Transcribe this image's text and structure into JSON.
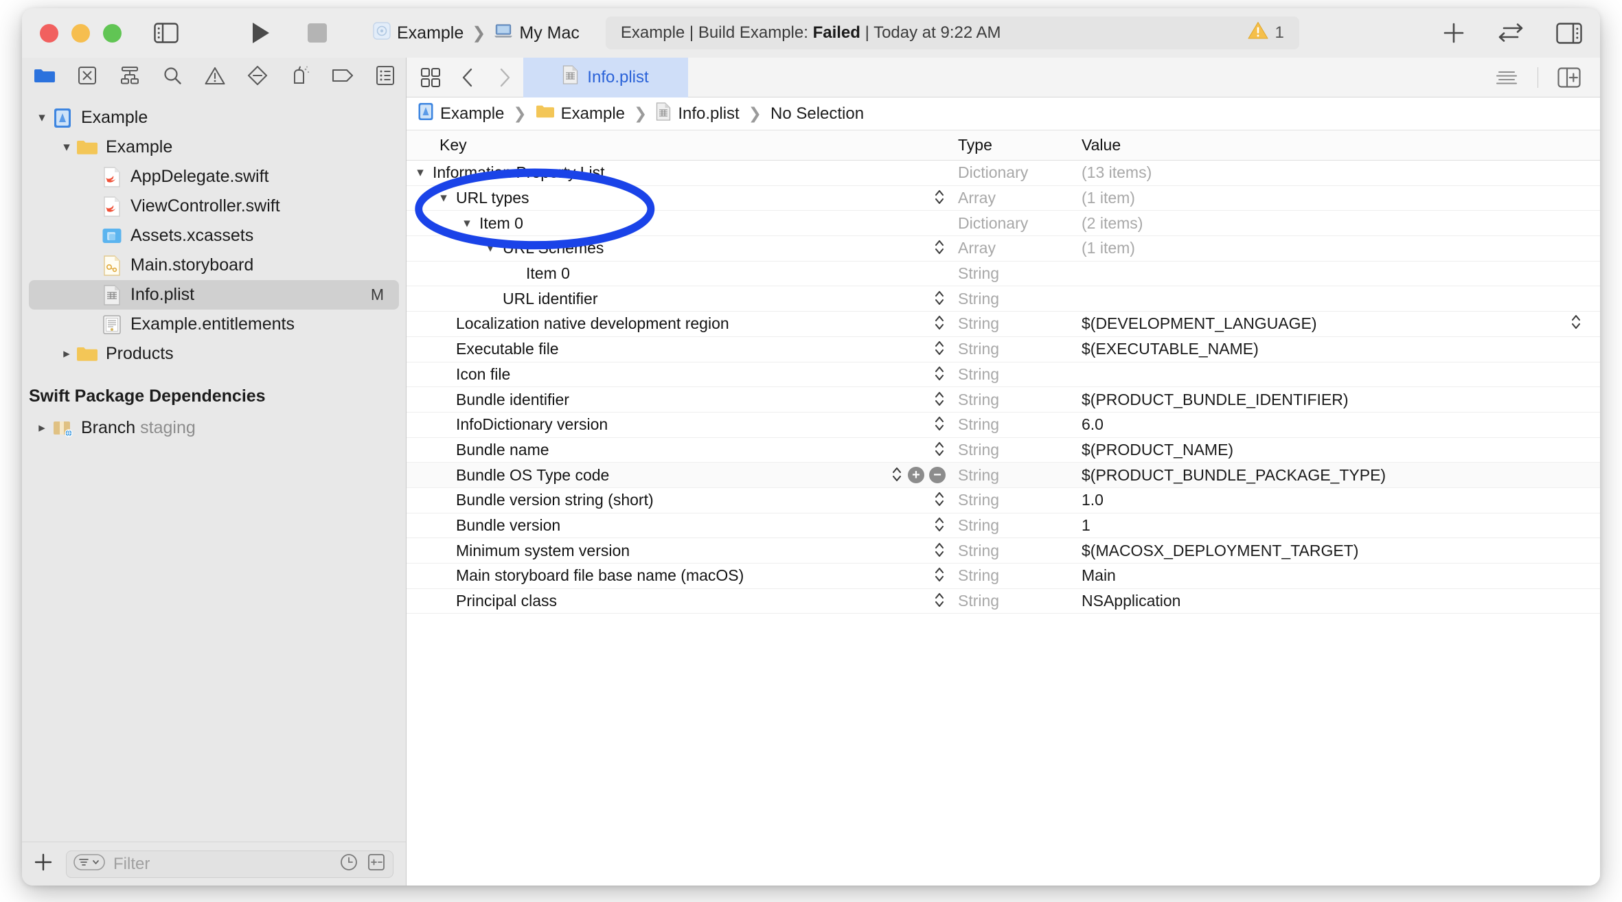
{
  "window": {
    "traffic_lights": [
      "close",
      "minimize",
      "zoom"
    ]
  },
  "toolbar": {
    "scheme_name": "Example",
    "destination": "My Mac",
    "status_prefix": "Example | Build Example: ",
    "status_result": "Failed",
    "status_suffix": " | Today at 9:22 AM",
    "separator": "|",
    "warning_count": "1",
    "add_label": "+",
    "sidebar_toggle_name": "toggle-navigator",
    "run_name": "run-button",
    "stop_name": "stop-button"
  },
  "navigator": {
    "toolbar_icons": [
      "project-navigator-icon",
      "source-control-navigator-icon",
      "hierarchy-navigator-icon",
      "find-navigator-icon",
      "issue-navigator-icon",
      "test-navigator-icon",
      "debug-navigator-icon",
      "breakpoint-navigator-icon",
      "report-navigator-icon"
    ],
    "tree": [
      {
        "label": "Example",
        "icon": "xcode-project-icon",
        "indent": 0,
        "disclosure": "open",
        "badge": ""
      },
      {
        "label": "Example",
        "icon": "folder-icon",
        "indent": 1,
        "disclosure": "open",
        "badge": ""
      },
      {
        "label": "AppDelegate.swift",
        "icon": "swift-file-icon",
        "indent": 2,
        "disclosure": "none",
        "badge": ""
      },
      {
        "label": "ViewController.swift",
        "icon": "swift-file-icon",
        "indent": 2,
        "disclosure": "none",
        "badge": ""
      },
      {
        "label": "Assets.xcassets",
        "icon": "assets-icon",
        "indent": 2,
        "disclosure": "none",
        "badge": ""
      },
      {
        "label": "Main.storyboard",
        "icon": "storyboard-icon",
        "indent": 2,
        "disclosure": "none",
        "badge": ""
      },
      {
        "label": "Info.plist",
        "icon": "plist-icon",
        "indent": 2,
        "disclosure": "none",
        "badge": "M",
        "selected": true
      },
      {
        "label": "Example.entitlements",
        "icon": "entitlements-icon",
        "indent": 2,
        "disclosure": "none",
        "badge": ""
      },
      {
        "label": "Products",
        "icon": "folder-icon",
        "indent": 1,
        "disclosure": "closed",
        "badge": ""
      }
    ],
    "section_title": "Swift Package Dependencies",
    "packages": [
      {
        "label": "Branch",
        "sublabel": "staging",
        "icon": "package-icon",
        "indent": 0,
        "disclosure": "closed"
      }
    ],
    "filter_placeholder": "Filter",
    "filter_value": "",
    "add_button_label": "+",
    "recent_icon": "clock-icon",
    "filter-levels_icon": "expand-collapse-icon"
  },
  "editor": {
    "tabs": [
      {
        "label": "Info.plist",
        "icon": "plist-icon",
        "active": true
      }
    ],
    "back_icon": "chevron-left-icon",
    "forward_icon": "chevron-right-icon",
    "grid_icon": "editor-options-icon",
    "minimap_icon": "minimap-icon",
    "split_icon": "add-editor-icon",
    "breadcrumb": [
      {
        "label": "Example",
        "icon": "xcode-project-icon"
      },
      {
        "label": "Example",
        "icon": "folder-icon"
      },
      {
        "label": "Info.plist",
        "icon": "plist-icon"
      },
      {
        "label": "No Selection",
        "icon": ""
      }
    ]
  },
  "plist": {
    "columns": {
      "key": "Key",
      "type": "Type",
      "value": "Value"
    },
    "rows": [
      {
        "key": "Information Property List",
        "indent": 0,
        "disclosure": "open",
        "stepper": false,
        "type": "Dictionary",
        "value": "(13 items)",
        "value_dim": true
      },
      {
        "key": "URL types",
        "indent": 1,
        "disclosure": "open",
        "stepper": true,
        "type": "Array",
        "value": "(1 item)",
        "value_dim": true
      },
      {
        "key": "Item 0",
        "indent": 2,
        "disclosure": "open",
        "stepper": false,
        "type": "Dictionary",
        "value": "(2 items)",
        "value_dim": true
      },
      {
        "key": "URL Schemes",
        "indent": 3,
        "disclosure": "open",
        "stepper": true,
        "type": "Array",
        "value": "(1 item)",
        "value_dim": true
      },
      {
        "key": "Item 0",
        "indent": 4,
        "disclosure": "none",
        "stepper": false,
        "type": "String",
        "value": "",
        "value_dim": false
      },
      {
        "key": "URL identifier",
        "indent": 3,
        "disclosure": "none",
        "stepper": true,
        "type": "String",
        "value": "",
        "value_dim": false
      },
      {
        "key": "Localization native development region",
        "indent": 1,
        "disclosure": "none",
        "stepper": true,
        "type": "String",
        "value": "$(DEVELOPMENT_LANGUAGE)",
        "value_dim": false,
        "value_stepper": true
      },
      {
        "key": "Executable file",
        "indent": 1,
        "disclosure": "none",
        "stepper": true,
        "type": "String",
        "value": "$(EXECUTABLE_NAME)",
        "value_dim": false
      },
      {
        "key": "Icon file",
        "indent": 1,
        "disclosure": "none",
        "stepper": true,
        "type": "String",
        "value": "",
        "value_dim": false
      },
      {
        "key": "Bundle identifier",
        "indent": 1,
        "disclosure": "none",
        "stepper": true,
        "type": "String",
        "value": "$(PRODUCT_BUNDLE_IDENTIFIER)",
        "value_dim": false
      },
      {
        "key": "InfoDictionary version",
        "indent": 1,
        "disclosure": "none",
        "stepper": true,
        "type": "String",
        "value": "6.0",
        "value_dim": false
      },
      {
        "key": "Bundle name",
        "indent": 1,
        "disclosure": "none",
        "stepper": true,
        "type": "String",
        "value": "$(PRODUCT_NAME)",
        "value_dim": false
      },
      {
        "key": "Bundle OS Type code",
        "indent": 1,
        "disclosure": "none",
        "stepper": true,
        "type": "String",
        "value": "$(PRODUCT_BUNDLE_PACKAGE_TYPE)",
        "value_dim": false,
        "hover": true,
        "add_remove": true
      },
      {
        "key": "Bundle version string (short)",
        "indent": 1,
        "disclosure": "none",
        "stepper": true,
        "type": "String",
        "value": "1.0",
        "value_dim": false
      },
      {
        "key": "Bundle version",
        "indent": 1,
        "disclosure": "none",
        "stepper": true,
        "type": "String",
        "value": "1",
        "value_dim": false
      },
      {
        "key": "Minimum system version",
        "indent": 1,
        "disclosure": "none",
        "stepper": true,
        "type": "String",
        "value": "$(MACOSX_DEPLOYMENT_TARGET)",
        "value_dim": false
      },
      {
        "key": "Main storyboard file base name (macOS)",
        "indent": 1,
        "disclosure": "none",
        "stepper": true,
        "type": "String",
        "value": "Main",
        "value_dim": false
      },
      {
        "key": "Principal class",
        "indent": 1,
        "disclosure": "none",
        "stepper": true,
        "type": "String",
        "value": "NSApplication",
        "value_dim": false
      }
    ]
  },
  "annotation": {
    "shape": "ellipse",
    "color": "#1a43e8",
    "encircles": [
      "URL Schemes",
      "Item 0"
    ]
  },
  "colors": {
    "accent_blue": "#2a62d8",
    "annotation_blue": "#1a43e8",
    "warning_yellow": "#f5bf4a",
    "tab_active_bg": "#cfdef8",
    "selection_gray": "#d0d0d0"
  }
}
